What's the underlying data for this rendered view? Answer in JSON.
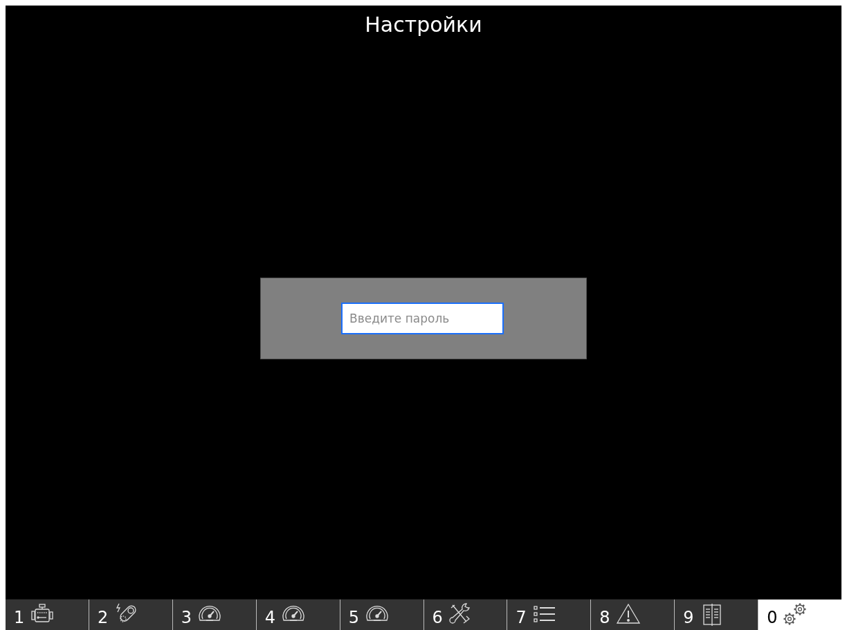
{
  "title": "Настройки",
  "password_dialog": {
    "placeholder": "Введите пароль"
  },
  "tabs": [
    {
      "label": "1",
      "kind": "engine",
      "selected": false
    },
    {
      "label": "2",
      "kind": "sensor",
      "selected": false
    },
    {
      "label": "3",
      "kind": "gauge",
      "selected": false
    },
    {
      "label": "4",
      "kind": "gauge",
      "selected": false
    },
    {
      "label": "5",
      "kind": "gauge",
      "selected": false
    },
    {
      "label": "6",
      "kind": "tools",
      "selected": false
    },
    {
      "label": "7",
      "kind": "list",
      "selected": false
    },
    {
      "label": "8",
      "kind": "warning",
      "selected": false
    },
    {
      "label": "9",
      "kind": "book",
      "selected": false
    },
    {
      "label": "0",
      "kind": "gears",
      "selected": true
    }
  ]
}
